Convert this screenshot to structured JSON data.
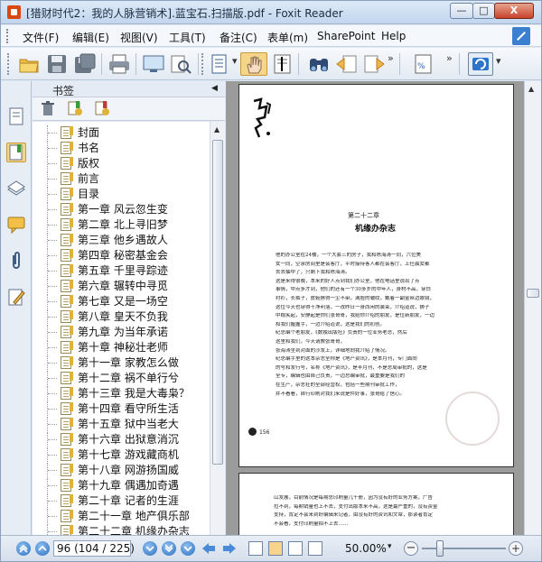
{
  "window": {
    "title": "[猎财时代2：我的人脉营销术].蓝宝石.扫描版.pdf - Foxit Reader",
    "min_glyph": "—",
    "max_glyph": "□",
    "close_glyph": "X"
  },
  "menu": {
    "items": [
      "文件(F)",
      "编辑(E)",
      "视图(V)",
      "工具(T)",
      "备注(C)",
      "表单(m)",
      "SharePoint",
      "Help"
    ]
  },
  "toolbar": {
    "icons": [
      "open-folder-icon",
      "save-icon",
      "save-as-icon",
      "print-icon",
      "fullscreen-icon",
      "find-text-icon",
      "page-view-icon",
      "hand-tool-icon",
      "select-text-icon",
      "binoculars-icon",
      "prev-view-icon",
      "next-view-icon",
      "zoom-percent-icon",
      "rotate-icon"
    ],
    "chevron": "»",
    "dropdown": "▾"
  },
  "bookmarks": {
    "title": "书签",
    "collapse_glyph": "◀",
    "tools": [
      "delete-bookmark-icon",
      "expand-bookmark-icon",
      "add-bookmark-icon"
    ],
    "items": [
      "封面",
      "书名",
      "版权",
      "前言",
      "目录",
      "第一章 风云忽生变",
      "第二章 北上寻旧梦",
      "第三章 他乡遇故人",
      "第四章 秘密基金会",
      "第五章 千里寻踪迹",
      "第六章 辗转中寻觅",
      "第七章 又是一场空",
      "第八章 皇天不负我",
      "第九章 为当年承诺",
      "第十章 神秘壮老师",
      "第十一章 家教怎么做",
      "第十二章 祸不单行兮",
      "第十三章 我是大毒枭？",
      "第十四章 看守所生活",
      "第十五章 狱中当老大",
      "第十六章 出狱意消沉",
      "第十七章 游戏藏商机",
      "第十八章 网游扬国威",
      "第十九章 偶遇加奇遇",
      "第二十章 记者的生涯",
      "第二十一章 地产俱乐部",
      "第二十二章 机缘办杂志"
    ]
  },
  "document": {
    "chapter_number": "第二十二章",
    "chapter_title": "机缘办杂志",
    "page_marker": "156",
    "lines": [
      "他的办公室在24楼，一个大套三的房子，我和陈海涛一同，六位美",
      "女一同，空余房间里是会客厅，平时接待客人都在会客厅，上任晨女都",
      "去去抽中了，只剩下我和陈海涛。",
      "这是来得很晚，本来的好人点到我们办公室，他在电话里说出了点",
      "事情，中点多才到，他们的还有一个30多岁的中年人，身材不高，穿白",
      "衬衫，长裤子，皮鞋擦得一尘不染，满脸的皱纹，戴着一副金丝边眼镜，",
      "这位今天也穿得干净利落，一改昨日一身西闲的装束，介绍道说，狮子",
      "中稳笑起，安静起是你们张哥哥，我给你介绍的朋友，是位新朋友，一边",
      "和我们握握手，一边介绍道说，这是我们的初创。",
      "纪总编个老朋友，《数独出版社》负责的一位业务老总，然后",
      "这里和我们，今天请教张哥哥，",
      "张海涛坐到对面的沙发上，详细地向我介绍了情况。",
      "纪总编手里的这本杂志全称是《地产资讯》，是本月刊，专门面向",
      "的号和发行号，名称《地产资讯》，是半月刊，不是总局审批的，这是",
      "全专，编辑也由自己负责，一边总编审批，最重要是我们的",
      "在生产，杂志社的全部经营权，包括一些期刊审批工作，",
      "并不看看，自行印刷对我们来说是件好事，张哥给了信心。"
    ],
    "page2_lines": [
      "山发展，目前情况是每期总印刷量几千册，因为没有好的业务方案，广告",
      "拉不到，每期销量也上不去，支付出版本来不高，这是最严重的，没有资金",
      "支持，肯定不会来到好编辑来记者，由没有好的资讯和文章，那读者肯定",
      "不会看，支付印刷量拍不上去……"
    ]
  },
  "status": {
    "page_display": "96 (104 / 225)",
    "zoom": "50.00%",
    "zoom_level": 0.25
  }
}
